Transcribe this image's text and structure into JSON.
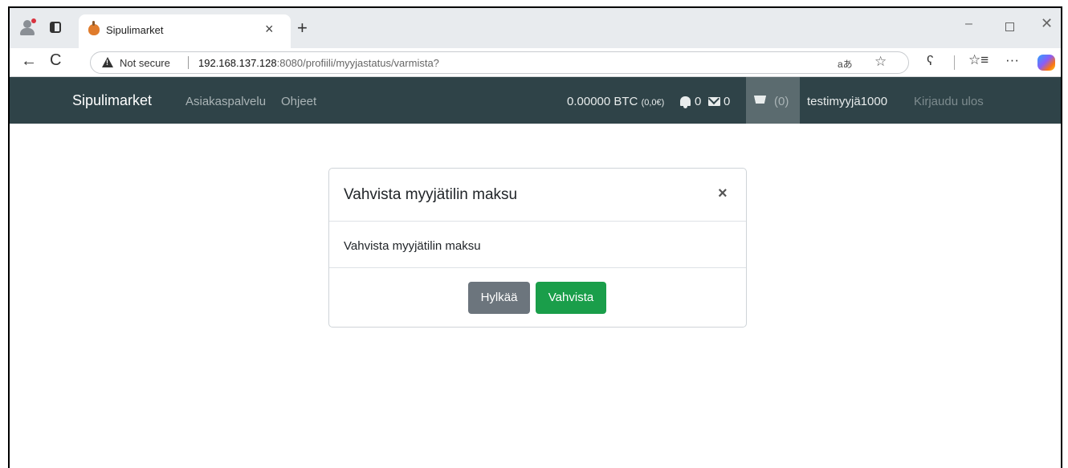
{
  "browser": {
    "tab_title": "Sipulimarket",
    "tab_close": "×",
    "new_tab": "+",
    "not_secure": "Not secure",
    "url_host": "192.168.137.128",
    "url_path": ":8080/profiili/myyjastatus/varmista?",
    "window_min": "–",
    "window_close": "✕",
    "back": "←",
    "reload": "C",
    "read_aloud": "aあ",
    "star": "☆",
    "extensions": "ʕ",
    "favorites": "☆≡",
    "more": "···"
  },
  "navbar": {
    "brand": "Sipulimarket",
    "links": [
      "Asiakaspalvelu",
      "Ohjeet"
    ],
    "balance_btc": "0.00000 BTC",
    "balance_eur": "(0,0€)",
    "notifications_count": "0",
    "messages_count": "0",
    "cart_count": "(0)",
    "username": "testimyyjä1000",
    "logout": "Kirjaudu ulos"
  },
  "modal": {
    "title": "Vahvista myyjätilin maksu",
    "close": "×",
    "body": "Vahvista myyjätilin maksu",
    "reject_label": "Hylkää",
    "confirm_label": "Vahvista"
  },
  "colors": {
    "navbar_bg": "#2f4348",
    "reject_btn": "#6c757d",
    "confirm_btn": "#1a9e4a"
  }
}
